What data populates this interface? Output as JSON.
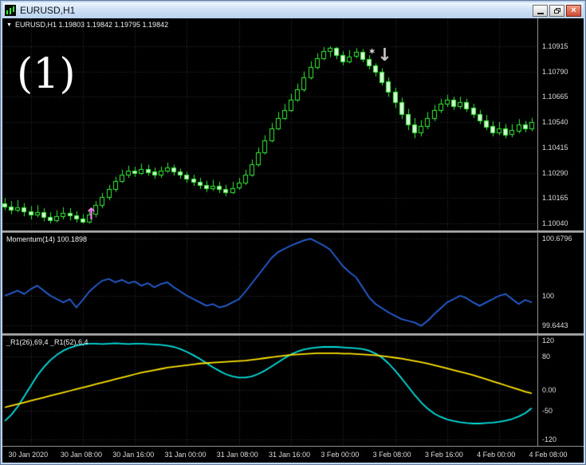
{
  "window": {
    "title": "EURUSD,H1"
  },
  "icons": {
    "chart_icon": "mini-candlestick-chart",
    "dropdown": "▼",
    "minimize": "_",
    "restore": "❐",
    "close": "×",
    "arrow_up": "↑",
    "arrow_down": "↓",
    "star": "*"
  },
  "colors": {
    "background": "#000000",
    "grid": "#35353f",
    "axis_text": "#dcdcdc",
    "candle": "#33ee33",
    "bull_fill": "#000000",
    "bear_fill": "#d9f7d9",
    "momentum_line": "#2761d9",
    "r1_fast": "#00e0e0",
    "r1_slow": "#ffe400",
    "marker_up": "#ea7ae4",
    "marker_down": "#c6c6c6",
    "annotation": "#ffffff"
  },
  "annotation": "(1)",
  "panes": {
    "price": {
      "header": "EURUSD,H1 1.19803 1.19842 1.19795 1.19842"
    },
    "momentum": {
      "header": "Momentum(14) 100.1898"
    },
    "r1": {
      "header": "_R1(26),69,4 _R1(52),6,4"
    }
  },
  "chart_data": {
    "type": "candlestick",
    "symbol": "EURUSD",
    "timeframe": "H1",
    "time_labels": [
      "30 Jan 2020",
      "30 Jan 08:00",
      "30 Jan 16:00",
      "31 Jan 00:00",
      "31 Jan 08:00",
      "31 Jan 16:00",
      "3 Feb 00:00",
      "3 Feb 08:00",
      "3 Feb 16:00",
      "4 Feb 00:00",
      "4 Feb 08:00"
    ],
    "price_pane": {
      "type": "candlestick",
      "ylim": [
        1.10005,
        1.11052
      ],
      "axis_labels": [
        "1.10915",
        "1.10790",
        "1.10665",
        "1.10540",
        "1.10415",
        "1.10290",
        "1.10165",
        "1.10040"
      ],
      "ohlc": [
        [
          1.1014,
          1.10165,
          1.10105,
          1.10125
        ],
        [
          1.10125,
          1.1015,
          1.10085,
          1.1011
        ],
        [
          1.1011,
          1.10155,
          1.10095,
          1.1012
        ],
        [
          1.1012,
          1.1014,
          1.10075,
          1.101
        ],
        [
          1.101,
          1.10125,
          1.1006,
          1.10085
        ],
        [
          1.10085,
          1.1013,
          1.1007,
          1.10095
        ],
        [
          1.10095,
          1.10115,
          1.1005,
          1.1007
        ],
        [
          1.1007,
          1.10095,
          1.1004,
          1.10055
        ],
        [
          1.10055,
          1.10105,
          1.10045,
          1.10075
        ],
        [
          1.10075,
          1.1012,
          1.1006,
          1.1009
        ],
        [
          1.1009,
          1.10115,
          1.10055,
          1.1008
        ],
        [
          1.1008,
          1.101,
          1.10045,
          1.10065
        ],
        [
          1.10065,
          1.10085,
          1.1004,
          1.1005
        ],
        [
          1.1005,
          1.1011,
          1.1004,
          1.10085
        ],
        [
          1.10085,
          1.1015,
          1.1007,
          1.1013
        ],
        [
          1.1013,
          1.1019,
          1.10115,
          1.1017
        ],
        [
          1.1017,
          1.1023,
          1.10155,
          1.1021
        ],
        [
          1.1021,
          1.1027,
          1.10195,
          1.1025
        ],
        [
          1.1025,
          1.10305,
          1.1024,
          1.1028
        ],
        [
          1.1028,
          1.10325,
          1.10265,
          1.103
        ],
        [
          1.103,
          1.1032,
          1.1027,
          1.1029
        ],
        [
          1.1029,
          1.10335,
          1.1028,
          1.1031
        ],
        [
          1.1031,
          1.1033,
          1.10275,
          1.10295
        ],
        [
          1.10295,
          1.10315,
          1.1026,
          1.1028
        ],
        [
          1.1028,
          1.1032,
          1.10265,
          1.103
        ],
        [
          1.103,
          1.1034,
          1.1029,
          1.10315
        ],
        [
          1.10315,
          1.1033,
          1.10275,
          1.10295
        ],
        [
          1.10295,
          1.1031,
          1.1026,
          1.1028
        ],
        [
          1.1028,
          1.10295,
          1.1024,
          1.1026
        ],
        [
          1.1026,
          1.1028,
          1.10225,
          1.10245
        ],
        [
          1.10245,
          1.10265,
          1.1021,
          1.1023
        ],
        [
          1.1023,
          1.1025,
          1.10195,
          1.10215
        ],
        [
          1.10215,
          1.10255,
          1.102,
          1.10225
        ],
        [
          1.10225,
          1.10245,
          1.1019,
          1.1021
        ],
        [
          1.1021,
          1.1023,
          1.10175,
          1.10195
        ],
        [
          1.10195,
          1.10245,
          1.10185,
          1.10215
        ],
        [
          1.10215,
          1.10265,
          1.10205,
          1.1024
        ],
        [
          1.1024,
          1.10305,
          1.1023,
          1.1028
        ],
        [
          1.1028,
          1.10355,
          1.1027,
          1.1033
        ],
        [
          1.1033,
          1.10415,
          1.1032,
          1.1039
        ],
        [
          1.1039,
          1.10475,
          1.1038,
          1.1045
        ],
        [
          1.1045,
          1.10535,
          1.1044,
          1.1051
        ],
        [
          1.1051,
          1.1059,
          1.105,
          1.1056
        ],
        [
          1.1056,
          1.1063,
          1.1055,
          1.106
        ],
        [
          1.106,
          1.1068,
          1.1059,
          1.1065
        ],
        [
          1.1065,
          1.1073,
          1.1064,
          1.107
        ],
        [
          1.107,
          1.1079,
          1.1069,
          1.1076
        ],
        [
          1.1076,
          1.1084,
          1.1075,
          1.1081
        ],
        [
          1.1081,
          1.1088,
          1.108,
          1.10855
        ],
        [
          1.10855,
          1.1091,
          1.10845,
          1.1089
        ],
        [
          1.1089,
          1.10915,
          1.1086,
          1.10905
        ],
        [
          1.10905,
          1.1091,
          1.1085,
          1.1087
        ],
        [
          1.1087,
          1.1089,
          1.1082,
          1.1084
        ],
        [
          1.1084,
          1.10895,
          1.1083,
          1.10865
        ],
        [
          1.10865,
          1.10905,
          1.10855,
          1.10885
        ],
        [
          1.10885,
          1.109,
          1.10835,
          1.1085
        ],
        [
          1.1085,
          1.1087,
          1.108,
          1.1082
        ],
        [
          1.1082,
          1.1083,
          1.10765,
          1.1079
        ],
        [
          1.1079,
          1.10805,
          1.1072,
          1.1074
        ],
        [
          1.1074,
          1.1076,
          1.10665,
          1.1069
        ],
        [
          1.1069,
          1.1071,
          1.1061,
          1.1064
        ],
        [
          1.1064,
          1.1066,
          1.10555,
          1.1058
        ],
        [
          1.1058,
          1.10605,
          1.105,
          1.1053
        ],
        [
          1.1053,
          1.1056,
          1.1046,
          1.1049
        ],
        [
          1.1049,
          1.1055,
          1.1047,
          1.1052
        ],
        [
          1.1052,
          1.1059,
          1.10505,
          1.1056
        ],
        [
          1.1056,
          1.10625,
          1.10545,
          1.106
        ],
        [
          1.106,
          1.10655,
          1.10585,
          1.1063
        ],
        [
          1.1063,
          1.10675,
          1.10615,
          1.1065
        ],
        [
          1.1065,
          1.10665,
          1.106,
          1.1062
        ],
        [
          1.1062,
          1.10665,
          1.10605,
          1.1064
        ],
        [
          1.1064,
          1.10655,
          1.1059,
          1.1061
        ],
        [
          1.1061,
          1.1063,
          1.1056,
          1.1058
        ],
        [
          1.1058,
          1.106,
          1.1053,
          1.1055
        ],
        [
          1.1055,
          1.10575,
          1.105,
          1.1052
        ],
        [
          1.1052,
          1.10545,
          1.1047,
          1.1049
        ],
        [
          1.1049,
          1.1054,
          1.10475,
          1.1051
        ],
        [
          1.1051,
          1.1053,
          1.1046,
          1.1048
        ],
        [
          1.1048,
          1.1053,
          1.10465,
          1.105
        ],
        [
          1.105,
          1.10555,
          1.10485,
          1.1053
        ],
        [
          1.1053,
          1.10545,
          1.1049,
          1.1051
        ],
        [
          1.1051,
          1.1056,
          1.10495,
          1.1054
        ]
      ],
      "markers": [
        {
          "name": "buy-arrow",
          "glyph": "↑",
          "index": 13,
          "color": "#ea7ae4"
        },
        {
          "name": "sell-arrow",
          "glyph": "↓",
          "index": 58,
          "color": "#c6c6c6"
        },
        {
          "name": "star",
          "glyph": "*",
          "index": 58,
          "color": "#e8e8e8"
        }
      ]
    },
    "momentum_pane": {
      "type": "line",
      "name": "Momentum(14)",
      "current_value": "100.1898",
      "ylim": [
        99.55,
        100.75
      ],
      "axis_labels": [
        "100.6796",
        "100",
        "99.6443"
      ],
      "values": [
        100.0,
        100.03,
        100.06,
        100.02,
        100.08,
        100.12,
        100.06,
        100.0,
        99.96,
        99.92,
        99.96,
        99.86,
        99.95,
        100.05,
        100.12,
        100.18,
        100.2,
        100.16,
        100.19,
        100.15,
        100.17,
        100.12,
        100.15,
        100.1,
        100.14,
        100.16,
        100.1,
        100.05,
        100.0,
        99.96,
        99.92,
        99.88,
        99.9,
        99.86,
        99.88,
        99.92,
        99.96,
        100.05,
        100.15,
        100.25,
        100.35,
        100.45,
        100.52,
        100.56,
        100.6,
        100.63,
        100.66,
        100.68,
        100.64,
        100.6,
        100.55,
        100.45,
        100.35,
        100.28,
        100.22,
        100.1,
        99.98,
        99.9,
        99.85,
        99.8,
        99.76,
        99.72,
        99.7,
        99.68,
        99.64,
        99.7,
        99.78,
        99.85,
        99.92,
        99.96,
        100.0,
        99.97,
        99.92,
        99.88,
        99.92,
        99.96,
        100.0,
        100.02,
        99.96,
        99.9,
        99.95,
        99.92
      ]
    },
    "r1_pane": {
      "type": "line",
      "ylim": [
        -135,
        131
      ],
      "axis_labels": [
        "120",
        "80",
        "0.00",
        "-50",
        "-120"
      ],
      "series": [
        {
          "name": "_R1(26),69,4",
          "color": "#00e0e0",
          "values": [
            -75,
            -60,
            -40,
            -15,
            10,
            35,
            55,
            72,
            85,
            95,
            102,
            107,
            110,
            112,
            112,
            111,
            112,
            113,
            112,
            111,
            112,
            112,
            111,
            110,
            109,
            107,
            104,
            99,
            92,
            84,
            75,
            65,
            55,
            46,
            38,
            33,
            30,
            30,
            33,
            39,
            47,
            57,
            67,
            77,
            86,
            93,
            98,
            101,
            103,
            104,
            104,
            104,
            103,
            102,
            101,
            99,
            95,
            88,
            78,
            64,
            47,
            28,
            8,
            -12,
            -30,
            -45,
            -57,
            -65,
            -71,
            -75,
            -78,
            -80,
            -81,
            -81,
            -80,
            -79,
            -77,
            -74,
            -70,
            -64,
            -56,
            -44
          ]
        },
        {
          "name": "_R1(52),6,4",
          "color": "#ffe400",
          "values": [
            -42,
            -38,
            -34,
            -30,
            -26,
            -22,
            -18,
            -14,
            -10,
            -6,
            -2,
            2,
            6,
            10,
            14,
            18,
            22,
            26,
            30,
            34,
            38,
            42,
            45,
            48,
            51,
            54,
            56,
            58,
            60,
            62,
            64,
            65,
            66,
            67,
            68,
            69,
            70,
            71,
            73,
            75,
            77,
            79,
            81,
            83,
            85,
            86,
            87,
            88,
            89,
            89,
            89,
            89,
            88,
            88,
            87,
            86,
            85,
            84,
            82,
            80,
            78,
            76,
            73,
            70,
            67,
            64,
            60,
            56,
            52,
            48,
            44,
            40,
            36,
            31,
            26,
            21,
            16,
            11,
            6,
            1,
            -4,
            -8
          ]
        }
      ]
    }
  }
}
